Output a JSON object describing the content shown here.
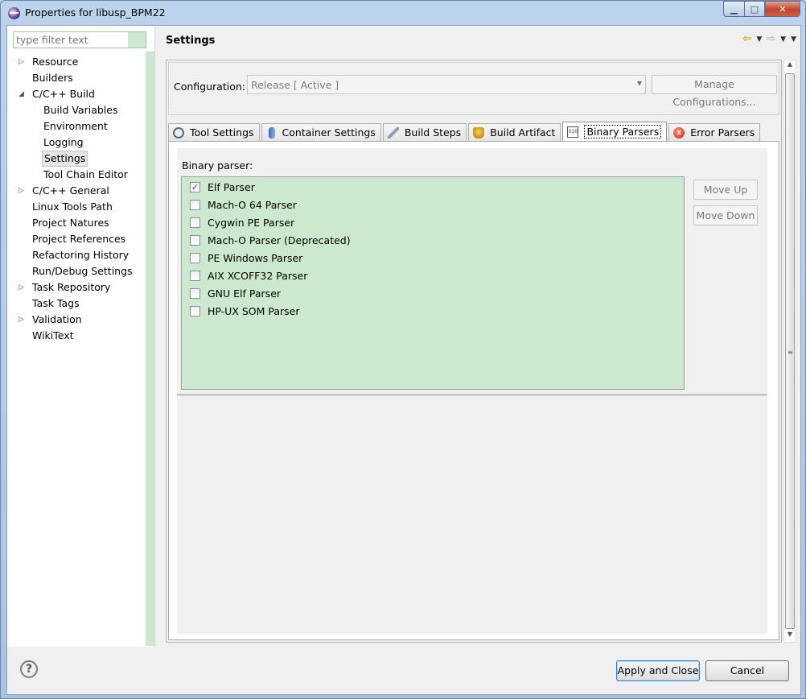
{
  "window": {
    "title": "Properties for libusp_BPM22",
    "minimize_glyph": "▁",
    "maximize_glyph": "□",
    "close_glyph": "✕"
  },
  "sidebar": {
    "filter_placeholder": "type filter text",
    "items": [
      {
        "label": "Resource",
        "twisty": "▷"
      },
      {
        "label": "Builders",
        "twisty": ""
      },
      {
        "label": "C/C++ Build",
        "twisty": "◢"
      },
      {
        "label": "Build Variables",
        "twisty": ""
      },
      {
        "label": "Environment",
        "twisty": ""
      },
      {
        "label": "Logging",
        "twisty": ""
      },
      {
        "label": "Settings",
        "twisty": ""
      },
      {
        "label": "Tool Chain Editor",
        "twisty": ""
      },
      {
        "label": "C/C++ General",
        "twisty": "▷"
      },
      {
        "label": "Linux Tools Path",
        "twisty": ""
      },
      {
        "label": "Project Natures",
        "twisty": ""
      },
      {
        "label": "Project References",
        "twisty": ""
      },
      {
        "label": "Refactoring History",
        "twisty": ""
      },
      {
        "label": "Run/Debug Settings",
        "twisty": ""
      },
      {
        "label": "Task Repository",
        "twisty": "▷"
      },
      {
        "label": "Task Tags",
        "twisty": ""
      },
      {
        "label": "Validation",
        "twisty": "▷"
      },
      {
        "label": "WikiText",
        "twisty": ""
      }
    ]
  },
  "header": {
    "title": "Settings",
    "back_glyph": "⇦",
    "forward_glyph": "⇨",
    "dropdown_glyph": "▼"
  },
  "configuration": {
    "label": "Configuration:",
    "value": "Release  [ Active ]",
    "manage_label": "Manage Configurations..."
  },
  "tabs": [
    {
      "label": "Tool Settings",
      "icon": "tool-settings-icon"
    },
    {
      "label": "Container Settings",
      "icon": "container-icon"
    },
    {
      "label": "Build Steps",
      "icon": "build-steps-icon"
    },
    {
      "label": "Build Artifact",
      "icon": "build-artifact-icon"
    },
    {
      "label": "Binary Parsers",
      "icon": "binary-icon"
    },
    {
      "label": "Error Parsers",
      "icon": "error-icon"
    }
  ],
  "binary_parsers": {
    "caption": "Binary parser:",
    "parsers": [
      {
        "label": "Elf Parser",
        "checked": true
      },
      {
        "label": "Mach-O 64 Parser",
        "checked": false
      },
      {
        "label": "Cygwin PE Parser",
        "checked": false
      },
      {
        "label": "Mach-O Parser (Deprecated)",
        "checked": false
      },
      {
        "label": "PE Windows Parser",
        "checked": false
      },
      {
        "label": "AIX XCOFF32 Parser",
        "checked": false
      },
      {
        "label": "GNU Elf Parser",
        "checked": false
      },
      {
        "label": "HP-UX SOM Parser",
        "checked": false
      }
    ],
    "move_up_label": "Move Up",
    "move_down_label": "Move Down"
  },
  "footer": {
    "help_glyph": "?",
    "apply_label": "Apply and Close",
    "cancel_label": "Cancel"
  },
  "colors": {
    "list_background": "#cce8cf",
    "title_bar": "#b9d1ea"
  }
}
